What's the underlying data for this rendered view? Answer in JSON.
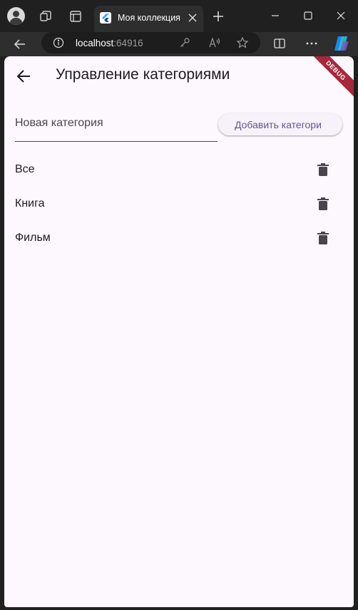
{
  "browser": {
    "tab_title": "Моя коллекция",
    "url_host": "localhost",
    "url_port": ":64916"
  },
  "app": {
    "title": "Управление категориями",
    "debug_label": "DEBUG",
    "new_category": {
      "placeholder": "Новая категория",
      "value": ""
    },
    "add_button_label": "Добавить категори",
    "categories": [
      {
        "label": "Все"
      },
      {
        "label": "Книга"
      },
      {
        "label": "Фильм"
      }
    ]
  },
  "colors": {
    "background": "#fdf7fe",
    "primary_text": "#1d1b20",
    "button_text": "#65558f",
    "debug_ribbon": "#a8273a",
    "browser_chrome": "#202020"
  },
  "icons": {
    "back": "arrow-left-icon",
    "delete": "trash-icon"
  }
}
